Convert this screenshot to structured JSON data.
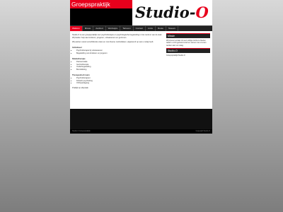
{
  "header": {
    "brand": "Groepspraktijk",
    "logo_main": "Studio-",
    "logo_accent": "O"
  },
  "nav": {
    "items": [
      "Welkom",
      "Missie",
      "Aanbod",
      "Werkwijze",
      "Tarieven",
      "Contact",
      "Links",
      "Route",
      "Nieuws"
    ]
  },
  "main": {
    "intro": "Studio-O is een groepspraktijk voor psychotherapie en psychologische begeleiding in het centrum van de stad. Wij bieden hulp aan kinderen, jongeren, volwassenen en gezinnen.",
    "intro2": "Wij werken vanuit verschillende visies en met diverse methodieken, afgestemd op wat u nodig heeft.",
    "sections": [
      {
        "title": "Individueel",
        "items": [
          "Psychotherapie bij volwassenen",
          "Begeleiding van kinderen en jongeren"
        ]
      },
      {
        "title": "Relatietherapie",
        "items": [
          "Partnerrelatie",
          "Gezinstherapie",
          "Ouderbegeleiding",
          "Bemiddeling"
        ]
      },
      {
        "title": "Therapeutisch team",
        "items": [
          "Psychotherapeut",
          "Klinisch psycholoog",
          "Orthopedagoog"
        ]
      }
    ],
    "closing": "Praktijk op afspraak"
  },
  "side": {
    "panel1_title": "Missie",
    "panel1_text": "Wij streven ernaar om een veilige ruimte te bieden waarin u zich gehoord voelt en samen met ons kan werken aan uw vraag.",
    "panel2_title": "Studio-O",
    "panel2_text": "Groepspraktijk Studio-O"
  },
  "footer": {
    "left": "Studio-O Groepspraktijk",
    "right": "Copyright Studio-O"
  }
}
